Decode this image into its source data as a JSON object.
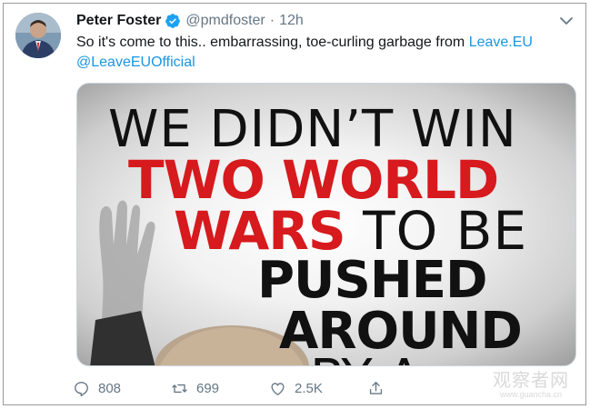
{
  "tweet": {
    "author_name": "Peter Foster",
    "verified": true,
    "handle": "@pmdfoster",
    "separator": "·",
    "time": "12h",
    "text_before": "So it's come to this.. embarrassing, toe-curling garbage from ",
    "link_text": "Leave.EU",
    "mention": "@LeaveEUOfficial"
  },
  "media": {
    "line1": "WE DIDN’T WIN",
    "line2": "TWO WORLD",
    "line3_red": "WARS",
    "line3_black": " TO BE",
    "line4": "PUSHED",
    "line5": "AROUND",
    "line6": "BY A"
  },
  "actions": {
    "replies": "808",
    "retweets": "699",
    "likes": "2.5K"
  },
  "watermark": {
    "main": "观察者网",
    "sub": "www.guancha.cn"
  },
  "colors": {
    "link": "#1b95e0",
    "verified": "#1da1f2",
    "poster_red": "#d61a1d",
    "meta_gray": "#657786"
  },
  "icons": [
    "verified-badge-icon",
    "chevron-down-icon",
    "reply-icon",
    "retweet-icon",
    "like-icon",
    "share-icon"
  ]
}
